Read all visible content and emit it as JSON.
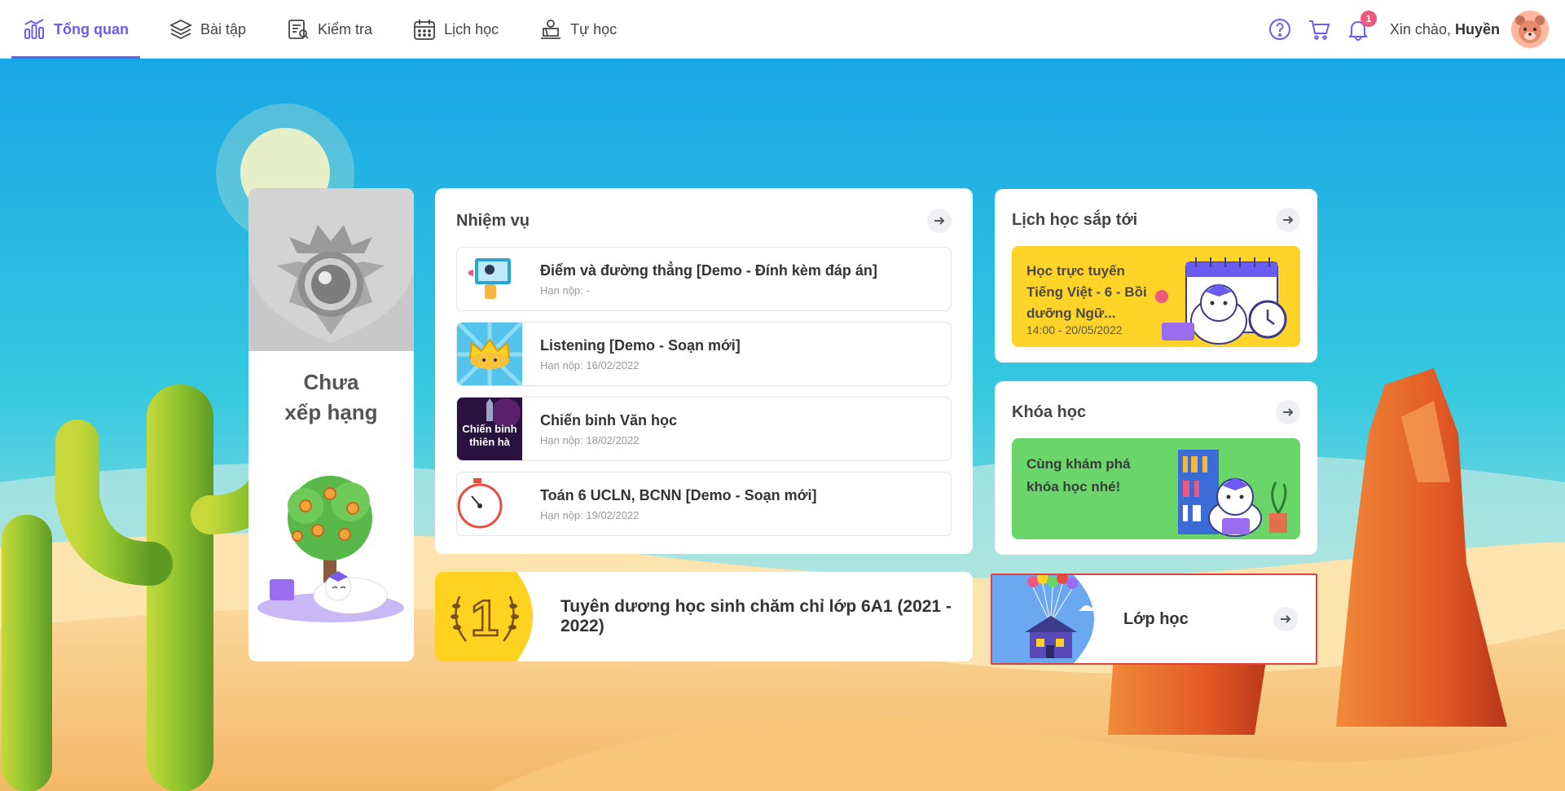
{
  "nav": {
    "items": [
      {
        "label": "Tổng quan",
        "icon": "chart-icon",
        "active": true
      },
      {
        "label": "Bài tập",
        "icon": "layers-icon"
      },
      {
        "label": "Kiểm tra",
        "icon": "test-icon"
      },
      {
        "label": "Lịch học",
        "icon": "calendar-icon"
      },
      {
        "label": "Tự học",
        "icon": "self-study-icon"
      }
    ]
  },
  "header": {
    "notification_count": "1",
    "greeting": "Xin chào,",
    "user_name": "Huyền"
  },
  "rank": {
    "label_line1": "Chưa",
    "label_line2": "xếp hạng"
  },
  "tasks": {
    "title": "Nhiệm vụ",
    "items": [
      {
        "title": "Điểm và đường thẳng [Demo - Đính kèm đáp án]",
        "due": "Hạn nộp: -"
      },
      {
        "title": "Listening [Demo - Soạn mới]",
        "due": "Hạn nộp: 16/02/2022"
      },
      {
        "title": "Chiến binh Văn học",
        "due": "Hạn nộp: 18/02/2022",
        "thumb_text_1": "Chiến binh",
        "thumb_text_2": "thiên hà"
      },
      {
        "title": "Toán 6 UCLN, BCNN [Demo - Soạn mới]",
        "due": "Hạn nộp: 19/02/2022"
      }
    ]
  },
  "award": {
    "text": "Tuyên dương học sinh chăm chỉ lớp 6A1 (2021 - 2022)",
    "rank_number": "1"
  },
  "schedule": {
    "title": "Lịch học sắp tới",
    "event_text": "Học trực tuyến Tiếng Việt - 6 - Bồi dưỡng Ngữ...",
    "event_time": "14:00 - 20/05/2022"
  },
  "courses": {
    "title": "Khóa học",
    "banner_text": "Cùng khám phá khóa học nhé!"
  },
  "classes": {
    "title": "Lớp học"
  },
  "colors": {
    "accent": "#6b5cf1",
    "badge": "#f0577f",
    "schedule_banner": "#ffd327",
    "course_banner": "#6ad66a",
    "award_circle": "#ffd21f",
    "class_circle": "#6aa8f2",
    "highlight_border": "#e0413e"
  }
}
